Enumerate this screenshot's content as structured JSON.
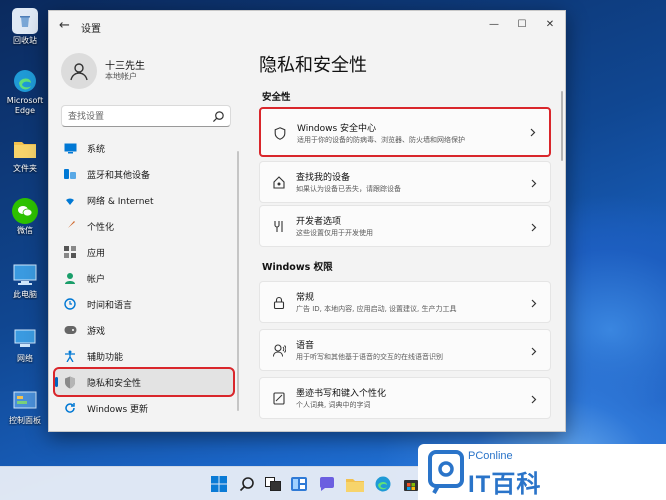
{
  "desktop": {
    "icons": [
      {
        "label": "回收站",
        "icon": "recycle-bin-icon",
        "color": "#dfe9f5"
      },
      {
        "label": "Microsoft Edge",
        "icon": "edge-icon",
        "color": "#1f9ad6"
      },
      {
        "label": "文件夹",
        "icon": "folder-icon",
        "color": "#f2c14e"
      },
      {
        "label": "微信",
        "icon": "wechat-icon",
        "color": "#2dc100"
      },
      {
        "label": "此电脑",
        "icon": "this-pc-icon",
        "color": "#3a9ae0"
      },
      {
        "label": "网络",
        "icon": "network-icon",
        "color": "#3a9ae0"
      },
      {
        "label": "控制面板",
        "icon": "control-panel-icon",
        "color": "#4a8fd8"
      }
    ]
  },
  "window": {
    "title": "设置",
    "back": "←",
    "controls": {
      "minimize": "—",
      "maximize": "☐",
      "close": "✕"
    }
  },
  "user": {
    "name": "十三先生",
    "account": "本地帐户"
  },
  "search": {
    "placeholder": "查找设置"
  },
  "sidebar": {
    "items": [
      {
        "label": "系统",
        "icon": "system-icon",
        "color": "#0078d4"
      },
      {
        "label": "蓝牙和其他设备",
        "icon": "bluetooth-icon",
        "color": "#0078d4"
      },
      {
        "label": "网络 & Internet",
        "icon": "network-wifi-icon",
        "color": "#0078d4"
      },
      {
        "label": "个性化",
        "icon": "personalization-icon",
        "color": "#d06a2f"
      },
      {
        "label": "应用",
        "icon": "apps-icon",
        "color": "#555555"
      },
      {
        "label": "帐户",
        "icon": "accounts-icon",
        "color": "#1a9e6a"
      },
      {
        "label": "时间和语言",
        "icon": "time-language-icon",
        "color": "#0078d4"
      },
      {
        "label": "游戏",
        "icon": "gaming-icon",
        "color": "#666666"
      },
      {
        "label": "辅助功能",
        "icon": "accessibility-icon",
        "color": "#0078d4"
      },
      {
        "label": "隐私和安全性",
        "icon": "privacy-shield-icon",
        "color": "#777777"
      },
      {
        "label": "Windows 更新",
        "icon": "windows-update-icon",
        "color": "#0078d4"
      }
    ],
    "active_index": 9
  },
  "main": {
    "title": "隐私和安全性",
    "sections": [
      {
        "title": "安全性",
        "cards": [
          {
            "title": "Windows 安全中心",
            "desc": "适用于你的设备的防病毒、浏览器、防火墙和网络保护",
            "icon": "shield-outline-icon"
          },
          {
            "title": "查找我的设备",
            "desc": "如果认为设备已丢失，请跟踪设备",
            "icon": "find-device-icon"
          },
          {
            "title": "开发者选项",
            "desc": "这些设置仅用于开发使用",
            "icon": "developer-tools-icon"
          }
        ]
      },
      {
        "title": "Windows 权限",
        "cards": [
          {
            "title": "常规",
            "desc": "广告 ID, 本地内容, 应用启动, 设置建议, 生产力工具",
            "icon": "lock-icon"
          },
          {
            "title": "语音",
            "desc": "用于听写和其他基于语音的交互的在线语音识别",
            "icon": "speech-icon"
          },
          {
            "title": "墨迹书写和键入个性化",
            "desc": "个人词典, 词典中的字词",
            "icon": "inking-typing-icon"
          }
        ]
      }
    ]
  },
  "taskbar": {
    "icons": [
      "start-icon",
      "search-icon",
      "task-view-icon",
      "widgets-icon",
      "chat-icon",
      "file-explorer-icon",
      "edge-icon",
      "store-icon"
    ]
  },
  "watermark": {
    "top": "PConline",
    "main": "IT百科",
    "logo": "pconline-logo-icon"
  },
  "colors": {
    "accent": "#0067c0",
    "highlight": "#d9262b"
  }
}
